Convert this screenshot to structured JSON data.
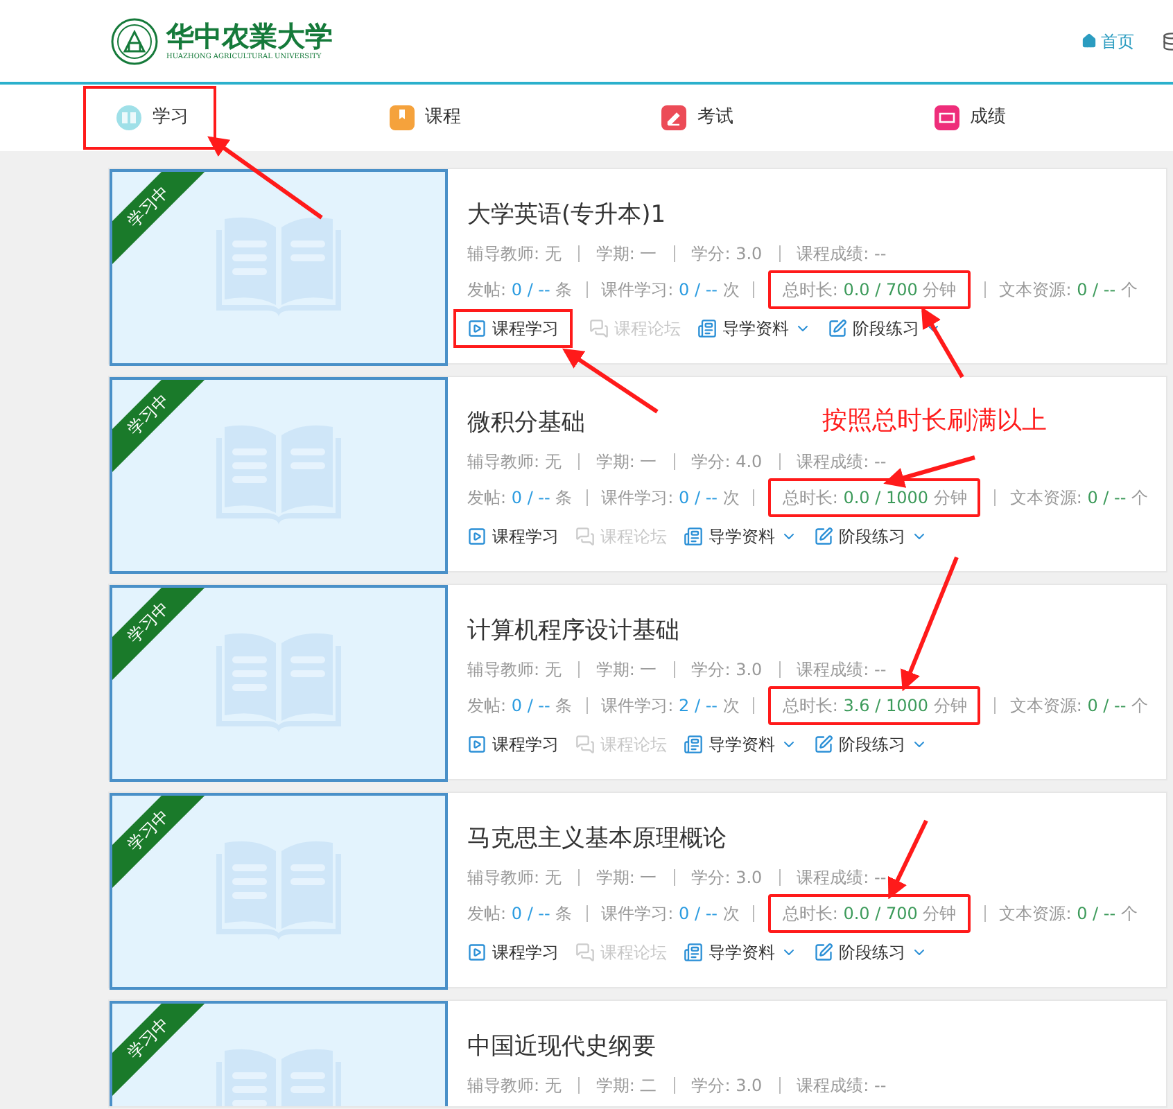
{
  "header": {
    "logo_name": "华中农業大学",
    "logo_subtitle": "HUAZHONG AGRICULTURAL UNIVERSITY",
    "home_link": "首页"
  },
  "nav": [
    {
      "label": "学习",
      "kind": "study",
      "highlighted": true
    },
    {
      "label": "课程",
      "kind": "course",
      "highlighted": false
    },
    {
      "label": "考试",
      "kind": "exam",
      "highlighted": false
    },
    {
      "label": "成绩",
      "kind": "grade",
      "highlighted": false
    }
  ],
  "annotation": "按照总时长刷满以上",
  "courses": [
    {
      "ribbon": "学习中",
      "title": "大学英语(专升本)1",
      "meta": [
        "辅导教师: 无",
        "学期: 一",
        "学分: 3.0",
        "课程成绩: --"
      ],
      "stats": [
        {
          "label": "发帖:",
          "value": "0 / --",
          "unit": "条",
          "color": "#2a9be0",
          "highlighted": false
        },
        {
          "label": "课件学习:",
          "value": "0 / --",
          "unit": "次",
          "color": "#2a9be0",
          "highlighted": false
        },
        {
          "label": "总时长:",
          "value": "0.0 / 700",
          "unit": "分钟",
          "color": "#3c9a5a",
          "highlighted": true
        },
        {
          "label": "文本资源:",
          "value": "0 / --",
          "unit": "个",
          "color": "#3c9a5a",
          "highlighted": false
        }
      ],
      "actions": [
        {
          "label": "课程学习",
          "kind": "study",
          "disabled": false,
          "highlighted": true
        },
        {
          "label": "课程论坛",
          "kind": "forum",
          "disabled": true,
          "highlighted": false
        },
        {
          "label": "导学资料",
          "kind": "guide",
          "disabled": false,
          "highlighted": false
        },
        {
          "label": "阶段练习",
          "kind": "exercise",
          "disabled": false,
          "highlighted": false
        }
      ]
    },
    {
      "ribbon": "学习中",
      "title": "微积分基础",
      "meta": [
        "辅导教师: 无",
        "学期: 一",
        "学分: 4.0",
        "课程成绩: --"
      ],
      "stats": [
        {
          "label": "发帖:",
          "value": "0 / --",
          "unit": "条",
          "color": "#2a9be0",
          "highlighted": false
        },
        {
          "label": "课件学习:",
          "value": "0 / --",
          "unit": "次",
          "color": "#2a9be0",
          "highlighted": false
        },
        {
          "label": "总时长:",
          "value": "0.0 / 1000",
          "unit": "分钟",
          "color": "#3c9a5a",
          "highlighted": true
        },
        {
          "label": "文本资源:",
          "value": "0 / --",
          "unit": "个",
          "color": "#3c9a5a",
          "highlighted": false
        }
      ],
      "actions": [
        {
          "label": "课程学习",
          "kind": "study",
          "disabled": false,
          "highlighted": false
        },
        {
          "label": "课程论坛",
          "kind": "forum",
          "disabled": true,
          "highlighted": false
        },
        {
          "label": "导学资料",
          "kind": "guide",
          "disabled": false,
          "highlighted": false
        },
        {
          "label": "阶段练习",
          "kind": "exercise",
          "disabled": false,
          "highlighted": false
        }
      ]
    },
    {
      "ribbon": "学习中",
      "title": "计算机程序设计基础",
      "meta": [
        "辅导教师: 无",
        "学期: 一",
        "学分: 3.0",
        "课程成绩: --"
      ],
      "stats": [
        {
          "label": "发帖:",
          "value": "0 / --",
          "unit": "条",
          "color": "#2a9be0",
          "highlighted": false
        },
        {
          "label": "课件学习:",
          "value": "2 / --",
          "unit": "次",
          "color": "#2a9be0",
          "highlighted": false
        },
        {
          "label": "总时长:",
          "value": "3.6 / 1000",
          "unit": "分钟",
          "color": "#3c9a5a",
          "highlighted": true
        },
        {
          "label": "文本资源:",
          "value": "0 / --",
          "unit": "个",
          "color": "#3c9a5a",
          "highlighted": false
        }
      ],
      "actions": [
        {
          "label": "课程学习",
          "kind": "study",
          "disabled": false,
          "highlighted": false
        },
        {
          "label": "课程论坛",
          "kind": "forum",
          "disabled": true,
          "highlighted": false
        },
        {
          "label": "导学资料",
          "kind": "guide",
          "disabled": false,
          "highlighted": false
        },
        {
          "label": "阶段练习",
          "kind": "exercise",
          "disabled": false,
          "highlighted": false
        }
      ]
    },
    {
      "ribbon": "学习中",
      "title": "马克思主义基本原理概论",
      "meta": [
        "辅导教师: 无",
        "学期: 一",
        "学分: 3.0",
        "课程成绩: --"
      ],
      "stats": [
        {
          "label": "发帖:",
          "value": "0 / --",
          "unit": "条",
          "color": "#2a9be0",
          "highlighted": false
        },
        {
          "label": "课件学习:",
          "value": "0 / --",
          "unit": "次",
          "color": "#2a9be0",
          "highlighted": false
        },
        {
          "label": "总时长:",
          "value": "0.0 / 700",
          "unit": "分钟",
          "color": "#3c9a5a",
          "highlighted": true
        },
        {
          "label": "文本资源:",
          "value": "0 / --",
          "unit": "个",
          "color": "#3c9a5a",
          "highlighted": false
        }
      ],
      "actions": [
        {
          "label": "课程学习",
          "kind": "study",
          "disabled": false,
          "highlighted": false
        },
        {
          "label": "课程论坛",
          "kind": "forum",
          "disabled": true,
          "highlighted": false
        },
        {
          "label": "导学资料",
          "kind": "guide",
          "disabled": false,
          "highlighted": false
        },
        {
          "label": "阶段练习",
          "kind": "exercise",
          "disabled": false,
          "highlighted": false
        }
      ]
    },
    {
      "ribbon": "学习中",
      "title": "中国近现代史纲要",
      "meta": [
        "辅导教师: 无",
        "学期: 二",
        "学分: 3.0",
        "课程成绩: --"
      ]
    }
  ]
}
